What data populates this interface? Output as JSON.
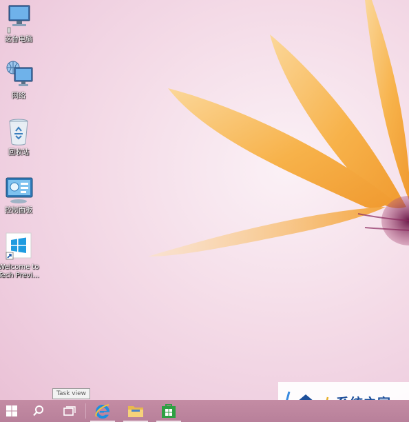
{
  "desktop": {
    "icons": [
      {
        "label": "这台电脑",
        "icon": "computer-icon"
      },
      {
        "label": "网络",
        "icon": "network-icon"
      },
      {
        "label": "回收站",
        "icon": "recycle-bin-icon"
      },
      {
        "label": "控制面板",
        "icon": "control-panel-icon"
      },
      {
        "label": "Welcome to Tech Previ...",
        "icon": "windows-shortcut-icon"
      }
    ]
  },
  "taskbar": {
    "tooltip": "Task view",
    "buttons": [
      {
        "icon": "start-icon"
      },
      {
        "icon": "search-icon"
      },
      {
        "icon": "task-view-icon"
      },
      {
        "icon": "internet-explorer-icon"
      },
      {
        "icon": "file-explorer-icon"
      },
      {
        "icon": "store-icon"
      }
    ]
  },
  "watermark": {
    "text": "系统之家"
  },
  "colors": {
    "taskbar": "#bd86a0",
    "accent_blue": "#1d4f9a",
    "petal": "#f7b24a"
  }
}
